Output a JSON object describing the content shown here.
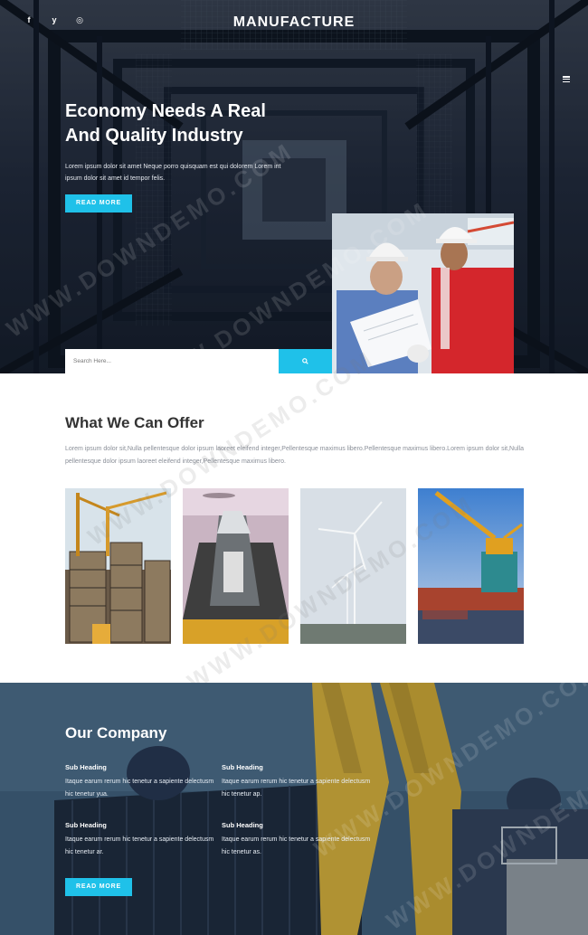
{
  "header": {
    "brand": "MANUFACTURE",
    "social": [
      {
        "icon": "facebook-icon",
        "glyph": "f"
      },
      {
        "icon": "twitter-icon",
        "glyph": "y"
      },
      {
        "icon": "pinterest-icon",
        "glyph": "◎"
      }
    ]
  },
  "hero": {
    "title_line1": "Economy Needs A Real",
    "title_line2": "And Quality Industry",
    "text": "Lorem ipsum dolor sit amet Neque porro quisquam est qui dolorem Lorem int ipsum dolor sit amet id tempor felis.",
    "button": "READ MORE",
    "search_placeholder": "Search Here..."
  },
  "offer": {
    "title": "What We Can Offer",
    "text": "Lorem ipsum dolor sit,Nulla pellentesque dolor ipsum laoreet eleifend integer,Pellentesque maximus libero.Pellentesque maximus libero.Lorem ipsum dolor sit,Nulla pellentesque dolor ipsum laoreet eleifend integer,Pellentesque maximus libero.",
    "cards": [
      "construction-cranes",
      "cargo-ship",
      "wind-turbines",
      "harbor-crane"
    ]
  },
  "company": {
    "title": "Our Company",
    "features": [
      {
        "heading": "Sub Heading",
        "text": "Itaque earum rerum hic tenetur a sapiente delectusm hic tenetur yua."
      },
      {
        "heading": "Sub Heading",
        "text": "Itaque earum rerum hic tenetur a sapiente delectusm hic tenetur ap."
      },
      {
        "heading": "Sub Heading",
        "text": "Itaque earum rerum hic tenetur a sapiente delectusm hic tenetur ar."
      },
      {
        "heading": "Sub Heading",
        "text": "Itaque earum rerum hic tenetur a sapiente delectusm hic tenetur as."
      }
    ],
    "button": "READ MORE"
  },
  "watermark": "WWW.DOWNDEMO.COM",
  "colors": {
    "accent": "#1fc1e9",
    "hero_bg": "#1c2433",
    "company_bg": "#3b5770"
  }
}
